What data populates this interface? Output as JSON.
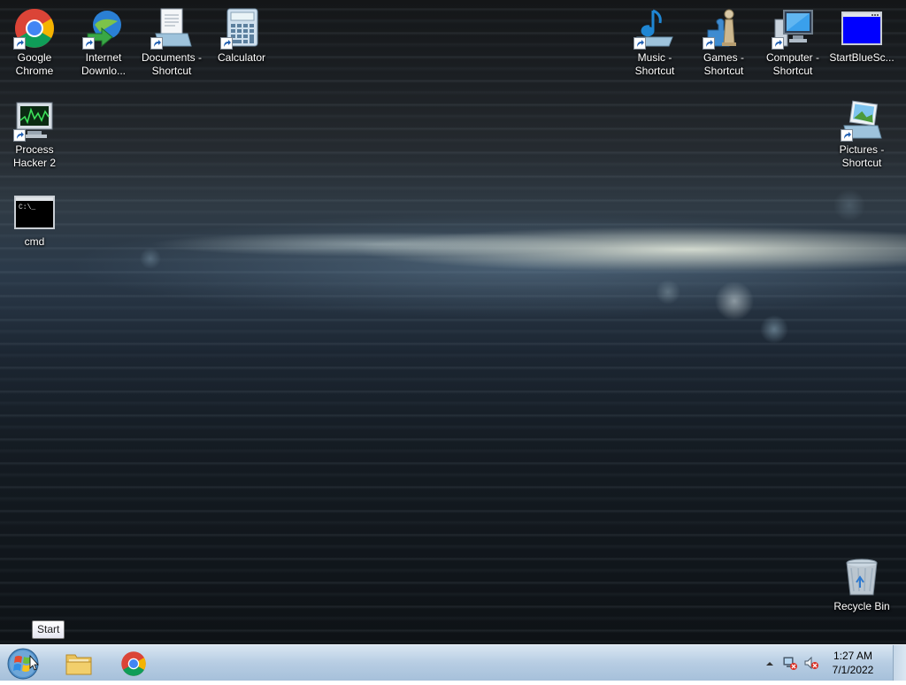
{
  "desktop": {
    "icons_left": [
      {
        "label": "Google Chrome",
        "icon": "chrome-icon"
      },
      {
        "label": "Internet Downlo...",
        "icon": "internet-download-manager-icon"
      },
      {
        "label": "Documents - Shortcut",
        "icon": "documents-icon"
      },
      {
        "label": "Calculator",
        "icon": "calculator-icon"
      },
      {
        "label": "Process Hacker 2",
        "icon": "process-hacker-icon"
      },
      {
        "label": "cmd",
        "icon": "cmd-icon"
      }
    ],
    "icons_right": [
      {
        "label": "Music - Shortcut",
        "icon": "music-icon"
      },
      {
        "label": "Games - Shortcut",
        "icon": "games-icon"
      },
      {
        "label": "Computer - Shortcut",
        "icon": "computer-icon"
      },
      {
        "label": "StartBlueSc...",
        "icon": "blue-screen-icon"
      },
      {
        "label": "Pictures - Shortcut",
        "icon": "pictures-icon"
      },
      {
        "label": "Recycle Bin",
        "icon": "recycle-bin-icon"
      }
    ]
  },
  "tooltip": {
    "text": "Start"
  },
  "taskbar": {
    "pinned": [
      {
        "name": "windows-explorer",
        "icon": "folder-icon"
      },
      {
        "name": "google-chrome",
        "icon": "chrome-icon"
      }
    ],
    "tray": {
      "icons": [
        "show-hidden-icons-arrow",
        "network-error-icon",
        "volume-muted-icon"
      ],
      "time": "1:27 AM",
      "date": "7/1/2022"
    }
  },
  "colors": {
    "taskbar": "#b7cde3",
    "desktop_text": "#ffffff",
    "accent_blue": "#0000ff"
  }
}
